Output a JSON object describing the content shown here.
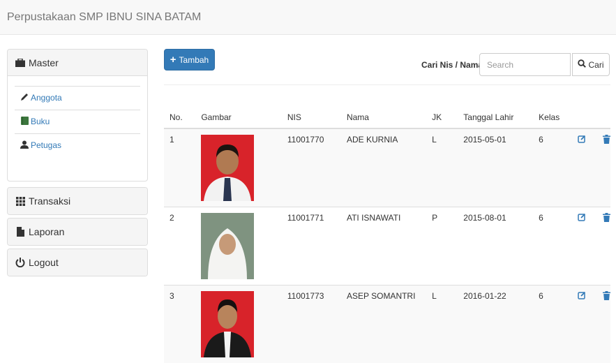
{
  "app": {
    "title": "Perpustakaan SMP IBNU SINA BATAM"
  },
  "sidebar": {
    "master": {
      "label": "Master",
      "items": [
        {
          "label": "Anggota",
          "icon": "pencil-icon"
        },
        {
          "label": "Buku",
          "icon": "book-icon"
        },
        {
          "label": "Petugas",
          "icon": "user-icon"
        }
      ]
    },
    "transaksi": "Transaksi",
    "laporan": "Laporan",
    "logout": "Logout"
  },
  "toolbar": {
    "add_label": "Tambah",
    "search_label": "Cari Nis / Nama",
    "search_placeholder": "Search",
    "search_button": "Cari"
  },
  "table": {
    "headers": [
      "No.",
      "Gambar",
      "NIS",
      "Nama",
      "JK",
      "Tanggal Lahir",
      "Kelas"
    ],
    "rows": [
      {
        "no": "1",
        "nis": "11001770",
        "nama": "ADE KURNIA",
        "jk": "L",
        "tgl": "2015-05-01",
        "kelas": "6",
        "photo_bg": "#d8232a"
      },
      {
        "no": "2",
        "nis": "11001771",
        "nama": "ATI ISNAWATI",
        "jk": "P",
        "tgl": "2015-08-01",
        "kelas": "6",
        "photo_bg": "#8a9a88"
      },
      {
        "no": "3",
        "nis": "11001773",
        "nama": "ASEP SOMANTRI",
        "jk": "L",
        "tgl": "2016-01-22",
        "kelas": "6",
        "photo_bg": "#d8232a"
      }
    ]
  },
  "colors": {
    "primary": "#337ab7",
    "navbar_bg": "#f8f8f8",
    "stripe": "#f9f9f9"
  }
}
